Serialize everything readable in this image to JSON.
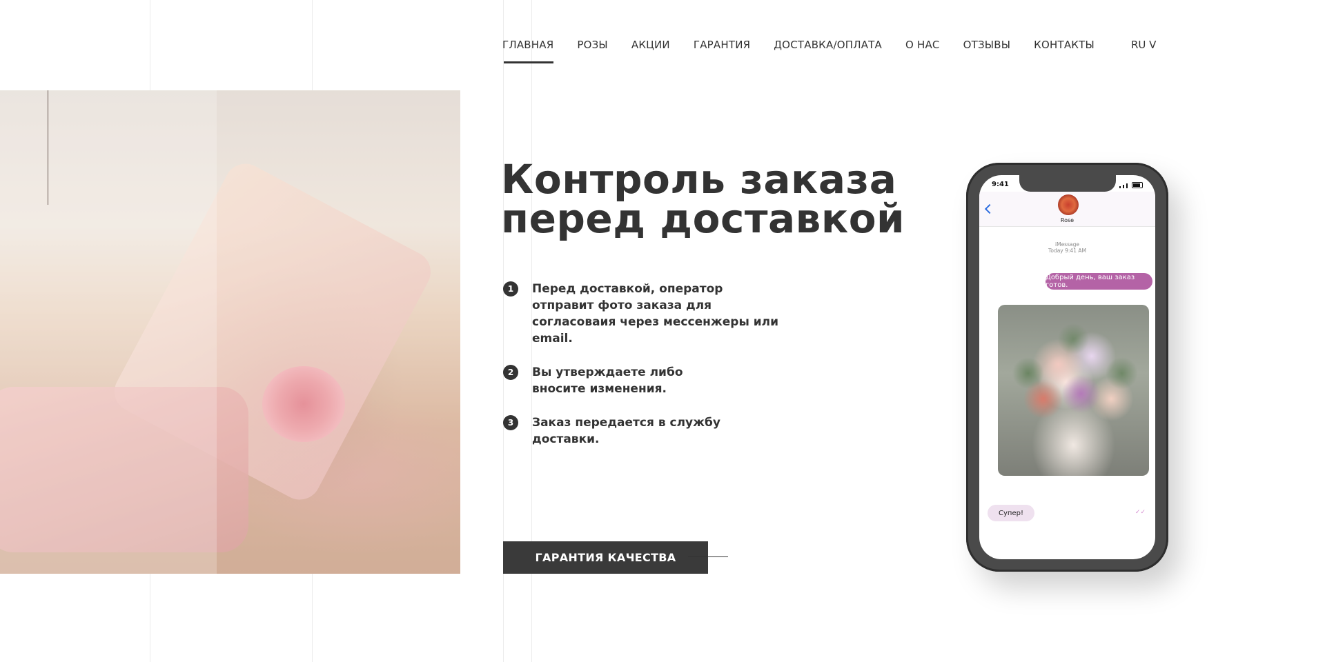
{
  "nav": {
    "items": [
      {
        "label": "ГЛАВНАЯ",
        "active": true
      },
      {
        "label": "РОЗЫ",
        "active": false
      },
      {
        "label": "АКЦИИ",
        "active": false
      },
      {
        "label": "ГАРАНТИЯ",
        "active": false
      },
      {
        "label": "ДОСТАВКА/ОПЛАТА",
        "active": false
      },
      {
        "label": "О НАС",
        "active": false
      },
      {
        "label": "ОТЗЫВЫ",
        "active": false
      },
      {
        "label": "КОНТАКТЫ",
        "active": false
      }
    ],
    "language": "RU V"
  },
  "hero": {
    "title_line1": "Контроль заказа",
    "title_line2": "перед доставкой",
    "steps": [
      {
        "number": "1",
        "text": "Перед доставкой, оператор отправит фото заказа для согласоваия через мессенжеры или email."
      },
      {
        "number": "2",
        "text": "Вы утверждаете либо вносите изменения."
      },
      {
        "number": "3",
        "text": "Заказ передается в службу доставки."
      }
    ],
    "cta_label": "ГАРАНТИЯ КАЧЕСТВА"
  },
  "phone": {
    "time": "9:41",
    "contact_name": "Rose",
    "service_label": "iMessage",
    "timestamp": "Today 9:41 AM",
    "outgoing_message": "Добрый день, ваш заказ готов.",
    "incoming_message": "Супер!",
    "read_mark": "✓✓"
  },
  "colors": {
    "text": "#333333",
    "cta_background": "#3a3a3a",
    "message_out": "#b463a6",
    "message_in": "#efe1ef",
    "back_chevron": "#2f6fe0"
  }
}
